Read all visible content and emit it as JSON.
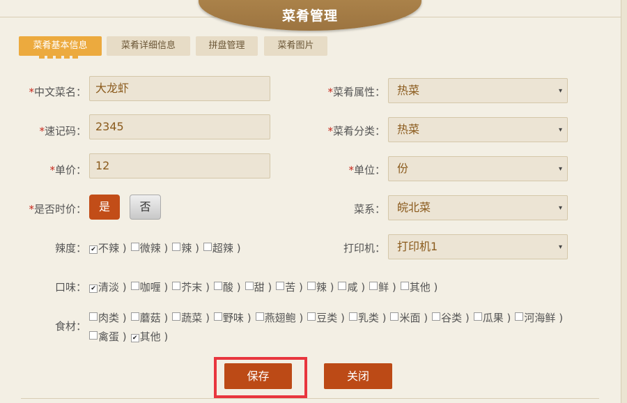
{
  "page_title": "菜肴管理",
  "tabs": [
    {
      "label": "菜肴基本信息",
      "active": true
    },
    {
      "label": "菜肴详细信息",
      "active": false
    },
    {
      "label": "拼盘管理",
      "active": false
    },
    {
      "label": "菜肴图片",
      "active": false
    }
  ],
  "form": {
    "chinese_name": {
      "label": "中文菜名：",
      "value": "大龙虾"
    },
    "quick_code": {
      "label": "速记码：",
      "value": "2345"
    },
    "price": {
      "label": "单价：",
      "value": "12"
    },
    "seasonal_price": {
      "label": "是否时价：",
      "yes": "是",
      "no": "否",
      "selected": "是"
    },
    "attribute": {
      "label": "菜肴属性：",
      "value": "热菜"
    },
    "category": {
      "label": "菜肴分类：",
      "value": "热菜"
    },
    "unit": {
      "label": "单位：",
      "value": "份"
    },
    "cuisine": {
      "label": "菜系：",
      "value": "皖北菜"
    },
    "printer": {
      "label": "打印机：",
      "value": "打印机1"
    },
    "required_mark": "*"
  },
  "spice": {
    "label": "辣度：",
    "options": [
      {
        "label": "不辣",
        "checked": true
      },
      {
        "label": "微辣",
        "checked": false
      },
      {
        "label": "辣",
        "checked": false
      },
      {
        "label": "超辣",
        "checked": false
      }
    ]
  },
  "taste": {
    "label": "口味：",
    "options": [
      {
        "label": "清淡",
        "checked": true
      },
      {
        "label": "咖喱",
        "checked": false
      },
      {
        "label": "芥末",
        "checked": false
      },
      {
        "label": "酸",
        "checked": false
      },
      {
        "label": "甜",
        "checked": false
      },
      {
        "label": "苦",
        "checked": false
      },
      {
        "label": "辣",
        "checked": false
      },
      {
        "label": "咸",
        "checked": false
      },
      {
        "label": "鲜",
        "checked": false
      },
      {
        "label": "其他",
        "checked": false
      }
    ]
  },
  "ingredients": {
    "label": "食材：",
    "options": [
      {
        "label": "肉类",
        "checked": false
      },
      {
        "label": "蘑菇",
        "checked": false
      },
      {
        "label": "蔬菜",
        "checked": false
      },
      {
        "label": "野味",
        "checked": false
      },
      {
        "label": "燕翅鲍",
        "checked": false
      },
      {
        "label": "豆类",
        "checked": false
      },
      {
        "label": "乳类",
        "checked": false
      },
      {
        "label": "米面",
        "checked": false
      },
      {
        "label": "谷类",
        "checked": false
      },
      {
        "label": "瓜果",
        "checked": false
      },
      {
        "label": "河海鲜",
        "checked": false
      },
      {
        "label": "禽蛋",
        "checked": false
      },
      {
        "label": "其他",
        "checked": true
      }
    ]
  },
  "actions": {
    "save": "保存",
    "close": "关闭"
  },
  "colors": {
    "accent": "#ecaa3e",
    "button": "#bc4a16",
    "highlight": "#e8363e",
    "header": "#a57c45"
  }
}
